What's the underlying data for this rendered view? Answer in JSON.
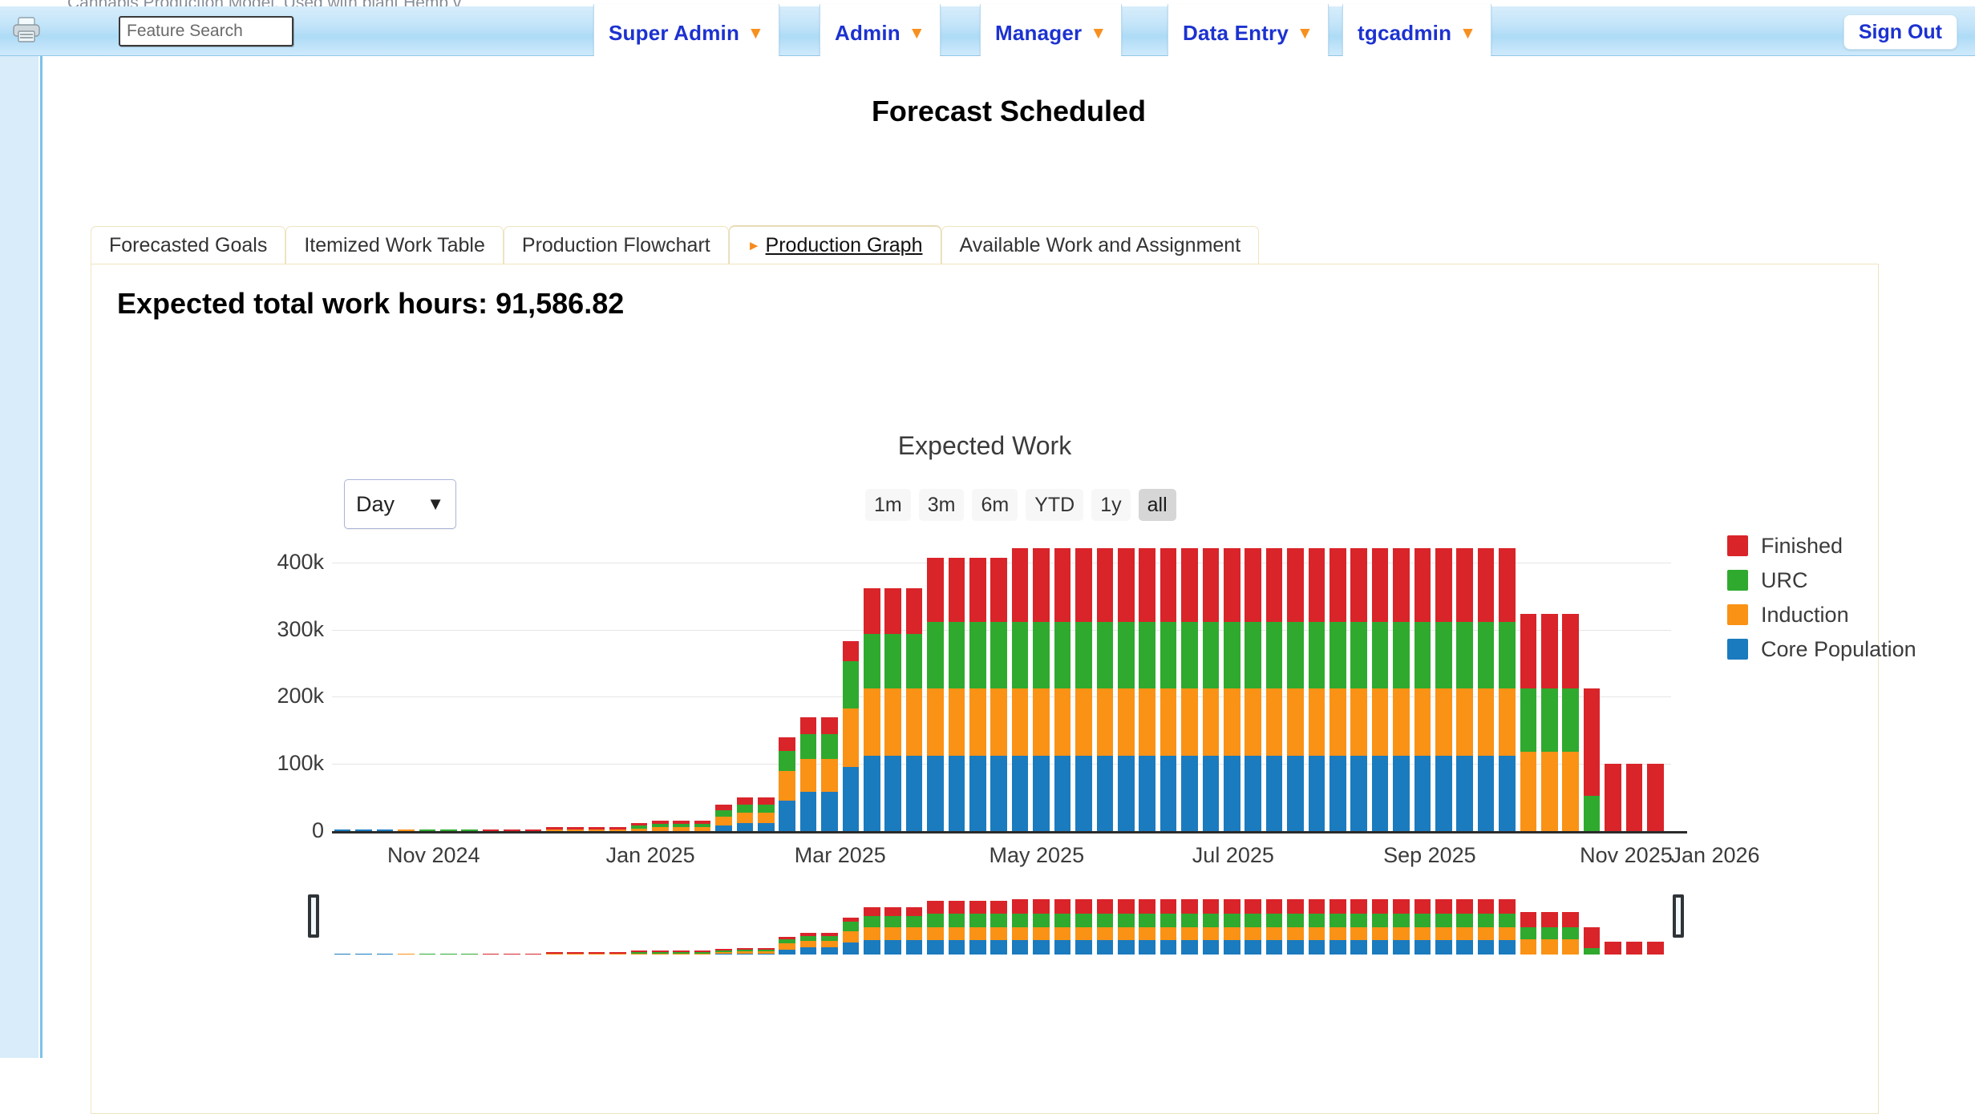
{
  "bleed_text": "Cannabis Production Model. Used with plant Hemp v",
  "toolbar": {
    "printer_icon": "printer-icon",
    "search": {
      "placeholder": "Feature Search",
      "value": ""
    },
    "nav_items": [
      {
        "label": "Super Admin",
        "caret": "▼"
      },
      {
        "label": "Admin",
        "caret": "▼"
      },
      {
        "label": "Manager",
        "caret": "▼"
      },
      {
        "label": "Data Entry",
        "caret": "▼"
      },
      {
        "label": "tgcadmin",
        "caret": "▼"
      }
    ],
    "sign_out": "Sign Out"
  },
  "page": {
    "title": "Forecast Scheduled",
    "hours_heading": "Expected total work hours: 91,586.82"
  },
  "tabs": [
    {
      "label": "Forecasted Goals",
      "active": false
    },
    {
      "label": "Itemized Work Table",
      "active": false
    },
    {
      "label": "Production Flowchart",
      "active": false
    },
    {
      "label": "Production Graph",
      "active": true
    },
    {
      "label": "Available Work and Assignment",
      "active": false
    }
  ],
  "chart_controls": {
    "period_value": "Day",
    "period_caret": "▼",
    "range_buttons": [
      {
        "label": "1m",
        "selected": false
      },
      {
        "label": "3m",
        "selected": false
      },
      {
        "label": "6m",
        "selected": false
      },
      {
        "label": "YTD",
        "selected": false
      },
      {
        "label": "1y",
        "selected": false
      },
      {
        "label": "all",
        "selected": true
      }
    ]
  },
  "colors": {
    "finished": "#d9242a",
    "urc": "#2faa2f",
    "induction": "#fa9216",
    "core_population": "#1b7bbf",
    "nav_accent": "#1c32d0",
    "tab_marker": "#f58b1f"
  },
  "chart_data": {
    "type": "bar",
    "title": "Expected Work",
    "subtitle": "",
    "xlabel": "",
    "ylabel": "",
    "ylim": [
      0,
      450000
    ],
    "grid": true,
    "stacked": true,
    "legend_position": "right",
    "ytick_labels": [
      "0",
      "100k",
      "200k",
      "300k",
      "400k"
    ],
    "ytick_values": [
      0,
      100000,
      200000,
      300000,
      400000
    ],
    "xtick_labels": [
      "Nov 2024",
      "Jan 2025",
      "Mar 2025",
      "May 2025",
      "Jul 2025",
      "Sep 2025",
      "Nov 2025",
      "Jan 2026"
    ],
    "legend": [
      {
        "name": "Finished",
        "color": "#d9242a"
      },
      {
        "name": "URC",
        "color": "#2faa2f"
      },
      {
        "name": "Induction",
        "color": "#fa9216"
      },
      {
        "name": "Core Population",
        "color": "#1b7bbf"
      }
    ],
    "categories": [
      "2024-10-20",
      "2024-10-27",
      "2024-11-03",
      "2024-11-10",
      "2024-11-17",
      "2024-11-24",
      "2024-12-01",
      "2024-12-08",
      "2024-12-15",
      "2024-12-22",
      "2024-12-29",
      "2025-01-05",
      "2025-01-12",
      "2025-01-19",
      "2025-01-26",
      "2025-02-02",
      "2025-02-09",
      "2025-02-16",
      "2025-02-23",
      "2025-03-02",
      "2025-03-09",
      "2025-03-16",
      "2025-03-23",
      "2025-03-30",
      "2025-04-06",
      "2025-04-13",
      "2025-04-20",
      "2025-04-27",
      "2025-05-04",
      "2025-05-11",
      "2025-05-18",
      "2025-05-25",
      "2025-06-01",
      "2025-06-08",
      "2025-06-15",
      "2025-06-22",
      "2025-06-29",
      "2025-07-06",
      "2025-07-13",
      "2025-07-20",
      "2025-07-27",
      "2025-08-03",
      "2025-08-10",
      "2025-08-17",
      "2025-08-24",
      "2025-08-31",
      "2025-09-07",
      "2025-09-14",
      "2025-09-21",
      "2025-09-28",
      "2025-10-05",
      "2025-10-12",
      "2025-10-19",
      "2025-10-26",
      "2025-11-02",
      "2025-11-09",
      "2025-11-16",
      "2025-11-23",
      "2025-11-30",
      "2025-12-07",
      "2025-12-14",
      "2025-12-21",
      "2025-12-28",
      "2026-01-04"
    ],
    "series": [
      {
        "name": "Core Population",
        "color": "#1b7bbf",
        "values": [
          2000,
          2000,
          2000,
          0,
          0,
          0,
          0,
          0,
          0,
          0,
          0,
          0,
          0,
          0,
          0,
          0,
          0,
          0,
          8000,
          12000,
          12000,
          45000,
          58000,
          58000,
          95000,
          112000,
          112000,
          112000,
          112000,
          112000,
          112000,
          112000,
          112000,
          112000,
          112000,
          112000,
          112000,
          112000,
          112000,
          112000,
          112000,
          112000,
          112000,
          112000,
          112000,
          112000,
          112000,
          112000,
          112000,
          112000,
          112000,
          112000,
          112000,
          112000,
          112000,
          112000,
          0,
          0,
          0,
          0,
          0,
          0,
          0,
          0
        ]
      },
      {
        "name": "Induction",
        "color": "#fa9216",
        "values": [
          0,
          0,
          0,
          2000,
          0,
          0,
          0,
          0,
          0,
          0,
          3000,
          3000,
          3000,
          3000,
          4000,
          6000,
          6000,
          6000,
          14000,
          16000,
          16000,
          45000,
          50000,
          50000,
          88000,
          100000,
          100000,
          100000,
          100000,
          100000,
          100000,
          100000,
          100000,
          100000,
          100000,
          100000,
          100000,
          100000,
          100000,
          100000,
          100000,
          100000,
          100000,
          100000,
          100000,
          100000,
          100000,
          100000,
          100000,
          100000,
          100000,
          100000,
          100000,
          100000,
          100000,
          100000,
          118000,
          118000,
          118000,
          0,
          0,
          0,
          0,
          0
        ]
      },
      {
        "name": "URC",
        "color": "#2faa2f",
        "values": [
          0,
          0,
          0,
          0,
          2500,
          2500,
          2500,
          0,
          0,
          0,
          0,
          0,
          0,
          0,
          4000,
          5000,
          5000,
          5000,
          9000,
          12000,
          12000,
          30000,
          36000,
          36000,
          70000,
          82000,
          82000,
          82000,
          100000,
          100000,
          100000,
          100000,
          100000,
          100000,
          100000,
          100000,
          100000,
          100000,
          100000,
          100000,
          100000,
          100000,
          100000,
          100000,
          100000,
          100000,
          100000,
          100000,
          100000,
          100000,
          100000,
          100000,
          100000,
          100000,
          100000,
          100000,
          95000,
          95000,
          95000,
          52000,
          0,
          0,
          0,
          0
        ]
      },
      {
        "name": "Finished",
        "color": "#d9242a",
        "values": [
          0,
          0,
          0,
          0,
          0,
          0,
          0,
          2500,
          2500,
          2500,
          3500,
          3500,
          3500,
          3500,
          4000,
          5000,
          5000,
          5000,
          8000,
          10000,
          10000,
          20000,
          25000,
          25000,
          30000,
          68000,
          68000,
          68000,
          95000,
          95000,
          95000,
          95000,
          110000,
          110000,
          110000,
          110000,
          110000,
          110000,
          110000,
          110000,
          110000,
          110000,
          110000,
          110000,
          110000,
          110000,
          110000,
          110000,
          110000,
          110000,
          110000,
          110000,
          110000,
          110000,
          110000,
          110000,
          110000,
          110000,
          110000,
          160000,
          100000,
          100000,
          100000,
          0
        ]
      }
    ]
  },
  "navigator": {
    "left_handle": "navigator-left-handle",
    "right_handle": "navigator-right-handle"
  }
}
